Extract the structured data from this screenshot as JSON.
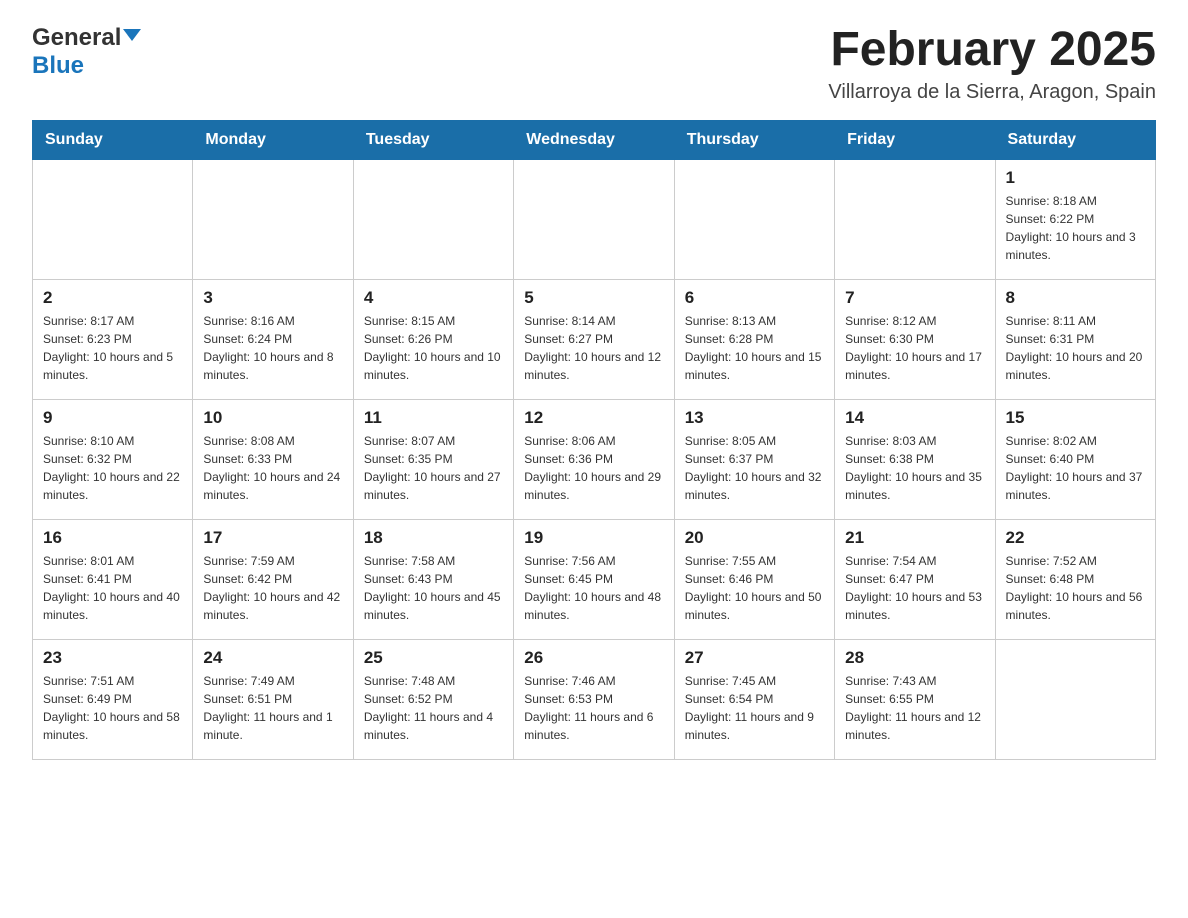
{
  "header": {
    "logo": {
      "general": "General",
      "blue": "Blue",
      "tagline": "GeneralBlue"
    },
    "title": "February 2025",
    "location": "Villarroya de la Sierra, Aragon, Spain"
  },
  "weekdays": [
    "Sunday",
    "Monday",
    "Tuesday",
    "Wednesday",
    "Thursday",
    "Friday",
    "Saturday"
  ],
  "weeks": [
    {
      "days": [
        {
          "number": "",
          "info": ""
        },
        {
          "number": "",
          "info": ""
        },
        {
          "number": "",
          "info": ""
        },
        {
          "number": "",
          "info": ""
        },
        {
          "number": "",
          "info": ""
        },
        {
          "number": "",
          "info": ""
        },
        {
          "number": "1",
          "info": "Sunrise: 8:18 AM\nSunset: 6:22 PM\nDaylight: 10 hours and 3 minutes."
        }
      ]
    },
    {
      "days": [
        {
          "number": "2",
          "info": "Sunrise: 8:17 AM\nSunset: 6:23 PM\nDaylight: 10 hours and 5 minutes."
        },
        {
          "number": "3",
          "info": "Sunrise: 8:16 AM\nSunset: 6:24 PM\nDaylight: 10 hours and 8 minutes."
        },
        {
          "number": "4",
          "info": "Sunrise: 8:15 AM\nSunset: 6:26 PM\nDaylight: 10 hours and 10 minutes."
        },
        {
          "number": "5",
          "info": "Sunrise: 8:14 AM\nSunset: 6:27 PM\nDaylight: 10 hours and 12 minutes."
        },
        {
          "number": "6",
          "info": "Sunrise: 8:13 AM\nSunset: 6:28 PM\nDaylight: 10 hours and 15 minutes."
        },
        {
          "number": "7",
          "info": "Sunrise: 8:12 AM\nSunset: 6:30 PM\nDaylight: 10 hours and 17 minutes."
        },
        {
          "number": "8",
          "info": "Sunrise: 8:11 AM\nSunset: 6:31 PM\nDaylight: 10 hours and 20 minutes."
        }
      ]
    },
    {
      "days": [
        {
          "number": "9",
          "info": "Sunrise: 8:10 AM\nSunset: 6:32 PM\nDaylight: 10 hours and 22 minutes."
        },
        {
          "number": "10",
          "info": "Sunrise: 8:08 AM\nSunset: 6:33 PM\nDaylight: 10 hours and 24 minutes."
        },
        {
          "number": "11",
          "info": "Sunrise: 8:07 AM\nSunset: 6:35 PM\nDaylight: 10 hours and 27 minutes."
        },
        {
          "number": "12",
          "info": "Sunrise: 8:06 AM\nSunset: 6:36 PM\nDaylight: 10 hours and 29 minutes."
        },
        {
          "number": "13",
          "info": "Sunrise: 8:05 AM\nSunset: 6:37 PM\nDaylight: 10 hours and 32 minutes."
        },
        {
          "number": "14",
          "info": "Sunrise: 8:03 AM\nSunset: 6:38 PM\nDaylight: 10 hours and 35 minutes."
        },
        {
          "number": "15",
          "info": "Sunrise: 8:02 AM\nSunset: 6:40 PM\nDaylight: 10 hours and 37 minutes."
        }
      ]
    },
    {
      "days": [
        {
          "number": "16",
          "info": "Sunrise: 8:01 AM\nSunset: 6:41 PM\nDaylight: 10 hours and 40 minutes."
        },
        {
          "number": "17",
          "info": "Sunrise: 7:59 AM\nSunset: 6:42 PM\nDaylight: 10 hours and 42 minutes."
        },
        {
          "number": "18",
          "info": "Sunrise: 7:58 AM\nSunset: 6:43 PM\nDaylight: 10 hours and 45 minutes."
        },
        {
          "number": "19",
          "info": "Sunrise: 7:56 AM\nSunset: 6:45 PM\nDaylight: 10 hours and 48 minutes."
        },
        {
          "number": "20",
          "info": "Sunrise: 7:55 AM\nSunset: 6:46 PM\nDaylight: 10 hours and 50 minutes."
        },
        {
          "number": "21",
          "info": "Sunrise: 7:54 AM\nSunset: 6:47 PM\nDaylight: 10 hours and 53 minutes."
        },
        {
          "number": "22",
          "info": "Sunrise: 7:52 AM\nSunset: 6:48 PM\nDaylight: 10 hours and 56 minutes."
        }
      ]
    },
    {
      "days": [
        {
          "number": "23",
          "info": "Sunrise: 7:51 AM\nSunset: 6:49 PM\nDaylight: 10 hours and 58 minutes."
        },
        {
          "number": "24",
          "info": "Sunrise: 7:49 AM\nSunset: 6:51 PM\nDaylight: 11 hours and 1 minute."
        },
        {
          "number": "25",
          "info": "Sunrise: 7:48 AM\nSunset: 6:52 PM\nDaylight: 11 hours and 4 minutes."
        },
        {
          "number": "26",
          "info": "Sunrise: 7:46 AM\nSunset: 6:53 PM\nDaylight: 11 hours and 6 minutes."
        },
        {
          "number": "27",
          "info": "Sunrise: 7:45 AM\nSunset: 6:54 PM\nDaylight: 11 hours and 9 minutes."
        },
        {
          "number": "28",
          "info": "Sunrise: 7:43 AM\nSunset: 6:55 PM\nDaylight: 11 hours and 12 minutes."
        },
        {
          "number": "",
          "info": ""
        }
      ]
    }
  ]
}
